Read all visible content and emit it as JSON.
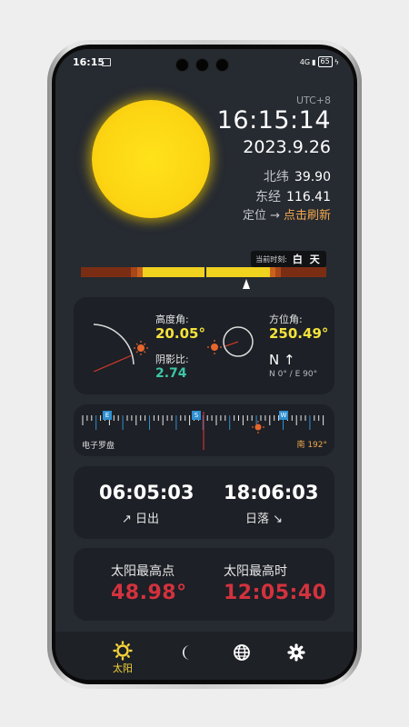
{
  "status_bar": {
    "time": "16:15",
    "network": "4G",
    "battery": "65"
  },
  "header": {
    "timezone": "UTC+8",
    "time": "16:15:14",
    "date": "2023.9.26",
    "lat_label": "北纬",
    "lat_value": "39.90",
    "lon_label": "东经",
    "lon_value": "116.41",
    "locate_label": "定位 →",
    "refresh_label": "点击刷新"
  },
  "period": {
    "current_label": "当前时刻:",
    "value": "白 天",
    "current_progress": 0.675
  },
  "angles": {
    "altitude_label": "高度角:",
    "altitude_value": "20.05°",
    "shadow_label": "阴影比:",
    "shadow_value": "2.74",
    "azimuth_label": "方位角:",
    "azimuth_value": "250.49°",
    "north_symbol": "N ↑",
    "north_coords": "N 0° / E 90°"
  },
  "compass": {
    "label": "电子罗盘",
    "direction": "南 192°",
    "markers": [
      "E",
      "S",
      "W"
    ]
  },
  "sun_times": {
    "sunrise_time": "06:05:03",
    "sunrise_label": "↗ 日出",
    "sunset_time": "18:06:03",
    "sunset_label": "日落 ↘"
  },
  "max": {
    "altitude_label": "太阳最高点",
    "altitude_value": "48.98°",
    "time_label": "太阳最高时",
    "time_value": "12:05:40"
  },
  "nav": {
    "items": [
      {
        "label": "太阳",
        "icon": "sun-icon"
      },
      {
        "icon": "moon-icon"
      },
      {
        "icon": "globe-icon"
      },
      {
        "icon": "settings-icon"
      }
    ]
  },
  "colors": {
    "accent_yellow": "#f4e23d",
    "accent_orange": "#f3a84e",
    "accent_red": "#d3323e",
    "accent_green": "#3dc6a4"
  }
}
